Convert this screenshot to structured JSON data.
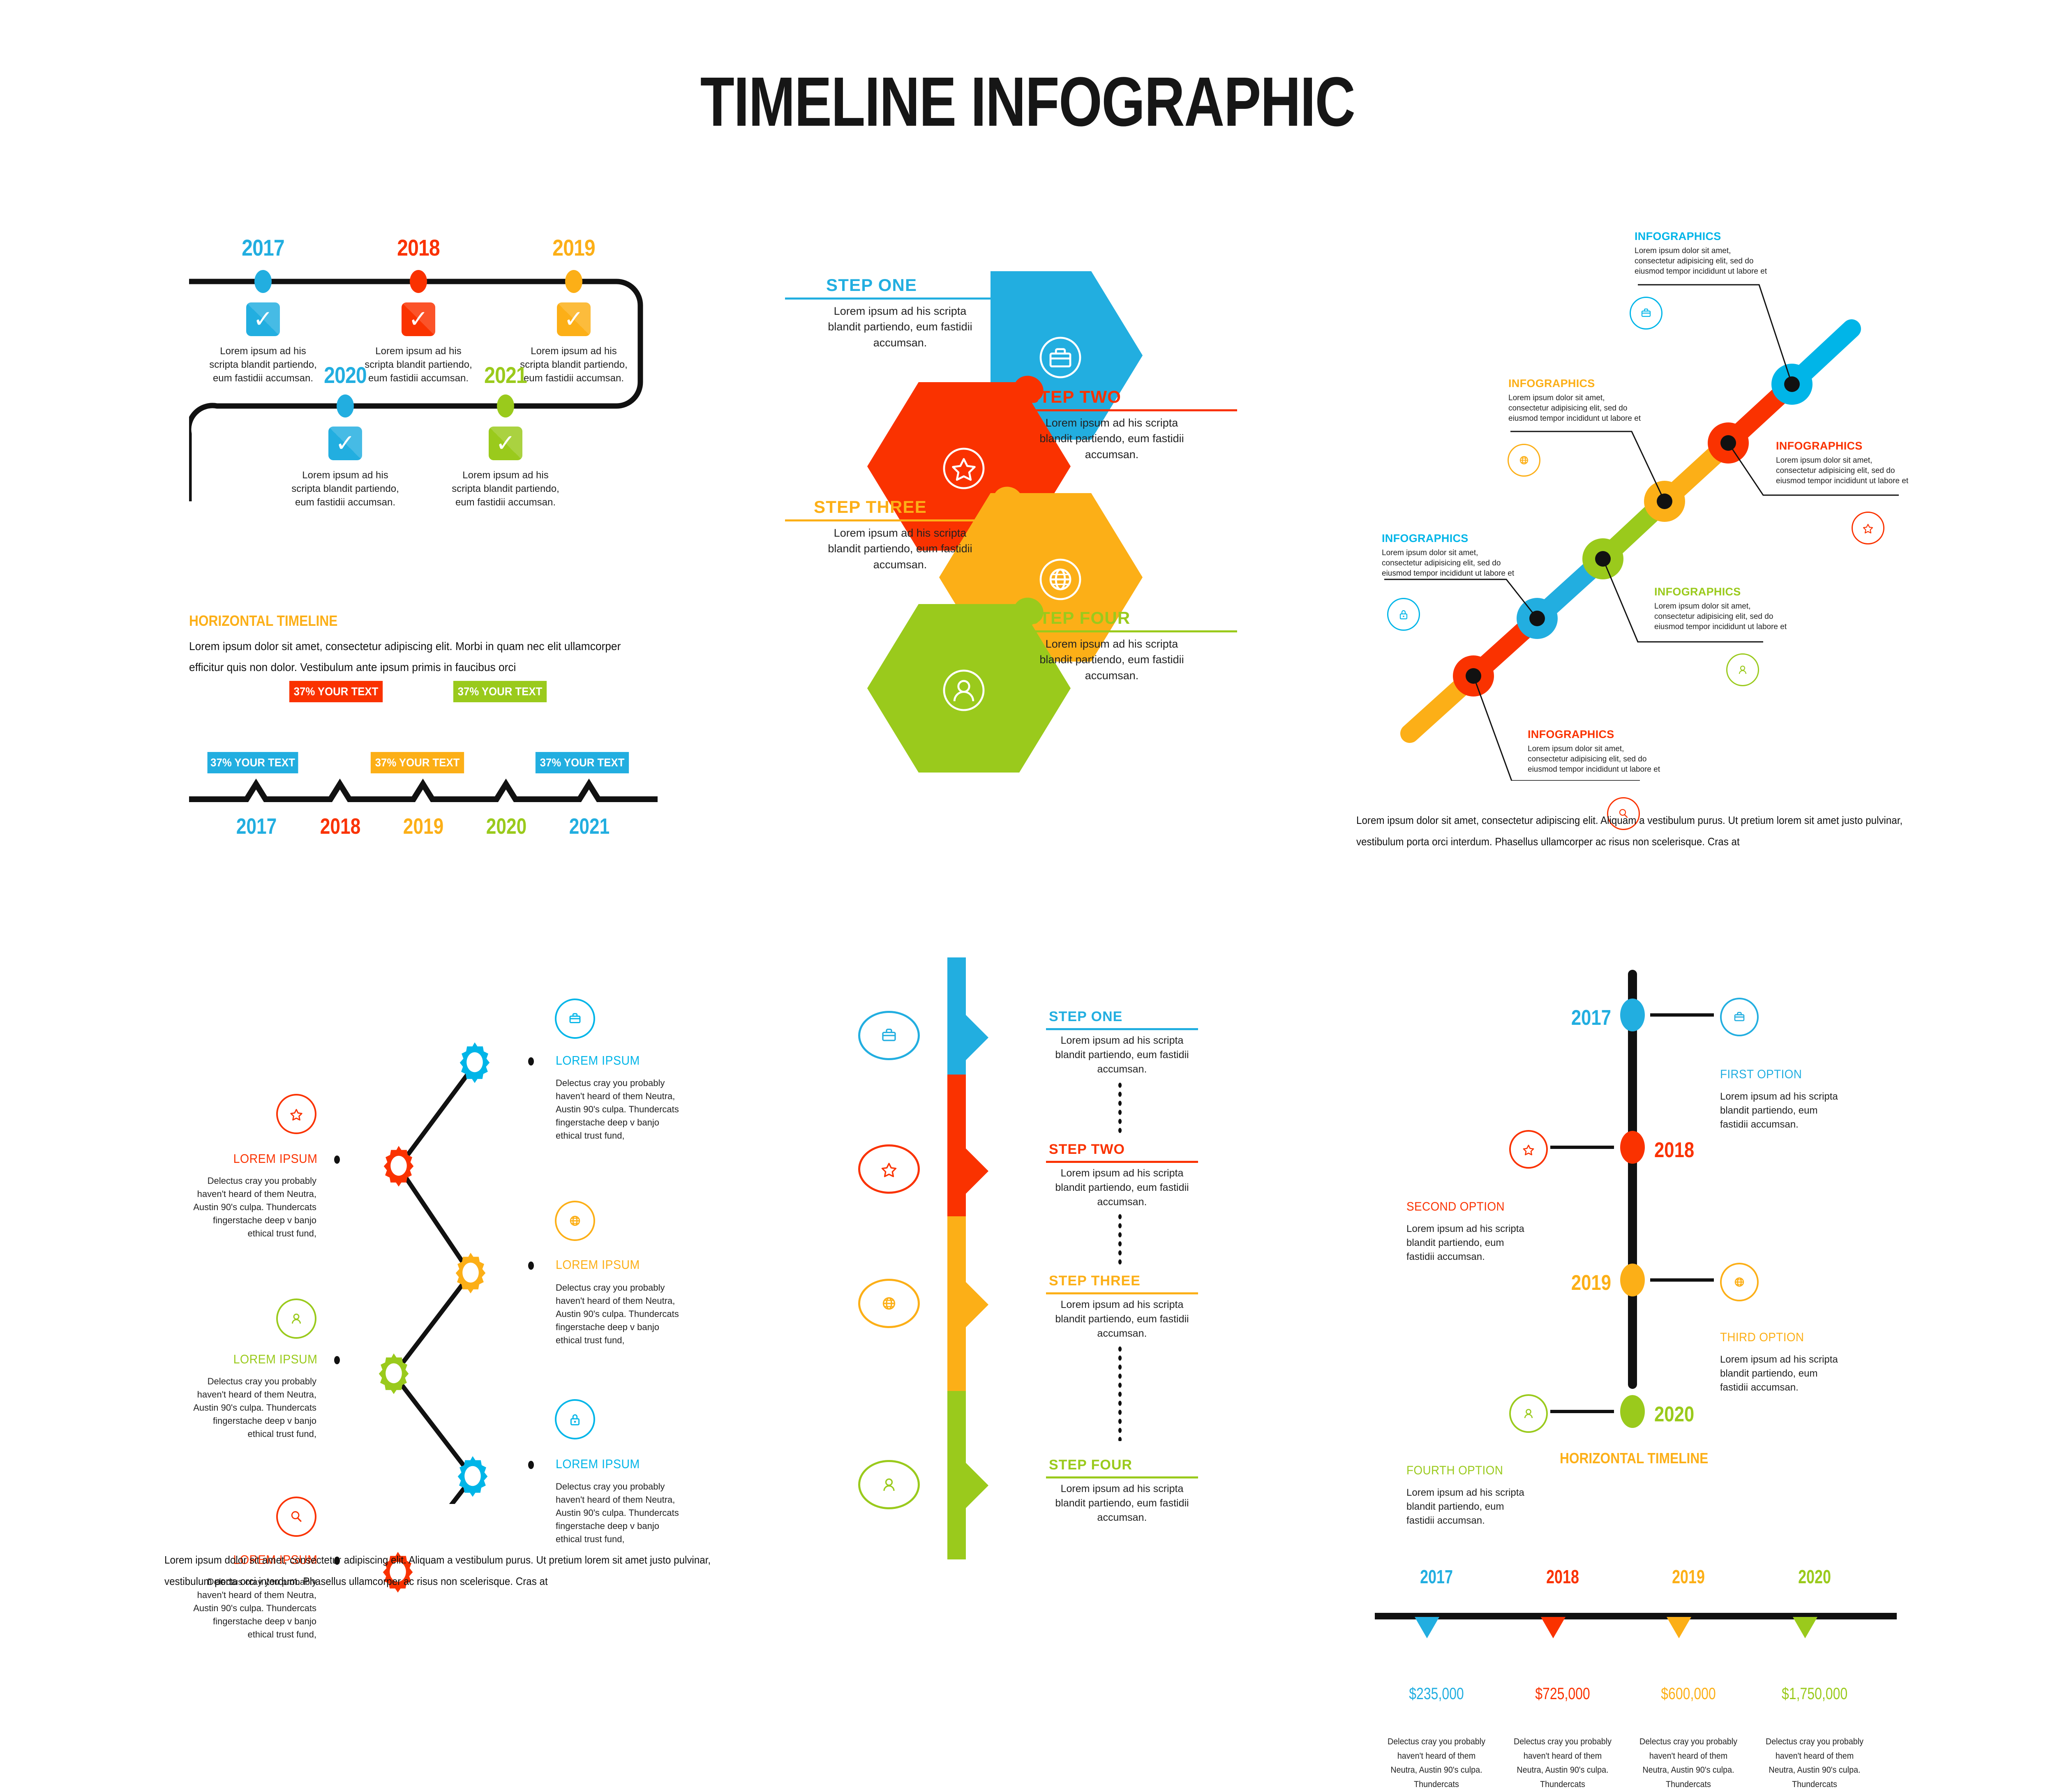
{
  "title": "TIMELINE INFOGRAPHIC",
  "colors": {
    "blue": "#22AEE0",
    "blue_bright": "#00B5E8",
    "red": "#FA3200",
    "orange": "#FCAF17",
    "orange_deep": "#F9A51A",
    "green": "#9ACA1C",
    "black": "#111111"
  },
  "lorem": {
    "short": "Lorem ipsum ad his scripta blandit partiendo, eum fastidii accumsan.",
    "info": "Lorem ipsum dolor sit amet, consectetur adipisicing elit, sed do eiusmod tempor incididunt ut labore et",
    "delectus": "Delectus cray you probably haven't heard of them Neutra, Austin 90's culpa. Thundercats fingerstache deep v banjo ethical trust fund,",
    "delectus_short": "Delectus cray you probably haven't heard of them Neutra, Austin 90's culpa. Thundercats"
  },
  "snake_timeline": {
    "items": [
      {
        "year": "2017",
        "color": "#22AEE0",
        "icon": "check-icon",
        "text": "Lorem ipsum ad his scripta blandit partiendo, eum fastidii accumsan."
      },
      {
        "year": "2018",
        "color": "#FA3200",
        "icon": "check-icon",
        "text": "Lorem ipsum ad his scripta blandit partiendo, eum fastidii accumsan."
      },
      {
        "year": "2019",
        "color": "#FCAF17",
        "icon": "check-icon",
        "text": "Lorem ipsum ad his scripta blandit partiendo, eum fastidii accumsan."
      },
      {
        "year": "2020",
        "color": "#22AEE0",
        "icon": "check-icon",
        "text": "Lorem ipsum ad his scripta blandit partiendo, eum fastidii accumsan."
      },
      {
        "year": "2021",
        "color": "#9ACA1C",
        "icon": "check-icon",
        "text": "Lorem ipsum ad his scripta blandit partiendo, eum fastidii accumsan."
      }
    ]
  },
  "horizontal_timeline": {
    "heading": "HORIZONTAL TIMELINE",
    "intro": "Lorem ipsum dolor sit amet, consectetur adipiscing elit. Morbi in quam nec elit ullamcorper efficitur quis non dolor. Vestibulum ante ipsum primis in faucibus orci",
    "badges": [
      {
        "label": "37% YOUR TEXT",
        "color": "#22AEE0",
        "row": "low"
      },
      {
        "label": "37% YOUR TEXT",
        "color": "#FA3200",
        "row": "high"
      },
      {
        "label": "37% YOUR TEXT",
        "color": "#FCAF17",
        "row": "low"
      },
      {
        "label": "37% YOUR TEXT",
        "color": "#9ACA1C",
        "row": "high"
      },
      {
        "label": "37% YOUR TEXT",
        "color": "#22AEE0",
        "row": "low"
      }
    ],
    "years": [
      {
        "label": "2017",
        "color": "#22AEE0"
      },
      {
        "label": "2018",
        "color": "#FA3200"
      },
      {
        "label": "2019",
        "color": "#FCAF17"
      },
      {
        "label": "2020",
        "color": "#9ACA1C"
      },
      {
        "label": "2021",
        "color": "#22AEE0"
      }
    ]
  },
  "puzzle_steps": {
    "items": [
      {
        "label": "STEP ONE",
        "color": "#22AEE0",
        "icon": "briefcase-icon",
        "text": "Lorem ipsum ad his scripta blandit partiendo, eum fastidii accumsan.",
        "side": "left"
      },
      {
        "label": "STEP TWO",
        "color": "#FA3200",
        "icon": "star-icon",
        "text": "Lorem ipsum ad his scripta blandit partiendo, eum fastidii accumsan.",
        "side": "right"
      },
      {
        "label": "STEP THREE",
        "color": "#FCAF17",
        "icon": "globe-icon",
        "text": "Lorem ipsum ad his scripta blandit partiendo, eum fastidii accumsan.",
        "side": "left"
      },
      {
        "label": "STEP FOUR",
        "color": "#9ACA1C",
        "icon": "user-icon",
        "text": "Lorem ipsum ad his scripta blandit partiendo, eum fastidii accumsan.",
        "side": "right"
      }
    ]
  },
  "diagonal_timeline": {
    "items": [
      {
        "label": "INFOGRAPHICS",
        "color": "#00B5E8",
        "icon": "briefcase-icon",
        "text": "Lorem ipsum dolor sit amet, consectetur adipisicing elit, sed do eiusmod tempor incididunt ut labore et"
      },
      {
        "label": "INFOGRAPHICS",
        "color": "#FA3200",
        "icon": "star-icon",
        "text": "Lorem ipsum dolor sit amet, consectetur adipisicing elit, sed do eiusmod tempor incididunt ut labore et"
      },
      {
        "label": "INFOGRAPHICS",
        "color": "#FCAF17",
        "icon": "globe-icon",
        "text": "Lorem ipsum dolor sit amet, consectetur adipisicing elit, sed do eiusmod tempor incididunt ut labore et"
      },
      {
        "label": "INFOGRAPHICS",
        "color": "#9ACA1C",
        "icon": "user-icon",
        "text": "Lorem ipsum dolor sit amet, consectetur adipisicing elit, sed do eiusmod tempor incididunt ut labore et"
      },
      {
        "label": "INFOGRAPHICS",
        "color": "#00B5E8",
        "icon": "lock-icon",
        "text": "Lorem ipsum dolor sit amet, consectetur adipisicing elit, sed do eiusmod tempor incididunt ut labore et"
      },
      {
        "label": "INFOGRAPHICS",
        "color": "#FA3200",
        "icon": "search-icon",
        "text": "Lorem ipsum dolor sit amet, consectetur adipisicing elit, sed do eiusmod tempor incididunt ut labore et"
      }
    ],
    "footer": "Lorem ipsum dolor sit amet, consectetur adipiscing elit. Aliquam a vestibulum purus. Ut pretium lorem sit amet justo pulvinar, vestibulum porta orci interdum. Phasellus ullamcorper ac risus non scelerisque. Cras at"
  },
  "gear_timeline": {
    "items": [
      {
        "label": "LOREM IPSUM",
        "color": "#00B5E8",
        "icon": "briefcase-icon",
        "side": "right",
        "text": "Delectus cray you probably haven't heard of them Neutra, Austin 90's culpa. Thundercats fingerstache deep v banjo ethical trust fund,"
      },
      {
        "label": "LOREM IPSUM",
        "color": "#FA3200",
        "icon": "star-icon",
        "side": "left",
        "text": "Delectus cray you probably haven't heard of them Neutra, Austin 90's culpa. Thundercats fingerstache deep v banjo ethical trust fund,"
      },
      {
        "label": "LOREM IPSUM",
        "color": "#FCAF17",
        "icon": "globe-icon",
        "side": "right",
        "text": "Delectus cray you probably haven't heard of them Neutra, Austin 90's culpa. Thundercats fingerstache deep v banjo ethical trust fund,"
      },
      {
        "label": "LOREM IPSUM",
        "color": "#9ACA1C",
        "icon": "user-icon",
        "side": "left",
        "text": "Delectus cray you probably haven't heard of them Neutra, Austin 90's culpa. Thundercats fingerstache deep v banjo ethical trust fund,"
      },
      {
        "label": "LOREM IPSUM",
        "color": "#00B5E8",
        "icon": "lock-icon",
        "side": "right",
        "text": "Delectus cray you probably haven't heard of them Neutra, Austin 90's culpa. Thundercats fingerstache deep v banjo ethical trust fund,"
      },
      {
        "label": "LOREM IPSUM",
        "color": "#FA3200",
        "icon": "search-icon",
        "side": "left",
        "text": "Delectus cray you probably haven't heard of them Neutra, Austin 90's culpa. Thundercats fingerstache deep v banjo ethical trust fund,"
      }
    ],
    "footer": "Lorem ipsum dolor sit amet, consectetur adipiscing elit. Aliquam a vestibulum purus. Ut pretium lorem sit amet justo pulvinar, vestibulum porta orci interdum. Phasellus ullamcorper ac risus non scelerisque. Cras at"
  },
  "vertical_steps": {
    "items": [
      {
        "label": "STEP ONE",
        "color": "#22AEE0",
        "icon": "briefcase-icon",
        "text": "Lorem ipsum ad his scripta blandit partiendo, eum fastidii accumsan."
      },
      {
        "label": "STEP TWO",
        "color": "#FA3200",
        "icon": "star-icon",
        "text": "Lorem ipsum ad his scripta blandit partiendo, eum fastidii accumsan."
      },
      {
        "label": "STEP THREE",
        "color": "#FCAF17",
        "icon": "globe-icon",
        "text": "Lorem ipsum ad his scripta blandit partiendo, eum fastidii accumsan."
      },
      {
        "label": "STEP FOUR",
        "color": "#9ACA1C",
        "icon": "user-icon",
        "text": "Lorem ipsum ad his scripta blandit partiendo, eum fastidii accumsan."
      }
    ]
  },
  "vertical_years": {
    "items": [
      {
        "year": "2017",
        "label": "FIRST OPTION",
        "color": "#22AEE0",
        "icon": "briefcase-icon",
        "side": "right",
        "text": "Lorem ipsum ad his scripta blandit partiendo, eum fastidii accumsan."
      },
      {
        "year": "2018",
        "label": "SECOND OPTION",
        "color": "#FA3200",
        "icon": "star-icon",
        "side": "left",
        "text": "Lorem ipsum ad his scripta blandit partiendo, eum fastidii accumsan."
      },
      {
        "year": "2019",
        "label": "THIRD OPTION",
        "color": "#FCAF17",
        "icon": "globe-icon",
        "side": "right",
        "text": "Lorem ipsum ad his scripta blandit partiendo, eum fastidii accumsan."
      },
      {
        "year": "2020",
        "label": "FOURTH OPTION",
        "color": "#9ACA1C",
        "icon": "user-icon",
        "side": "left",
        "text": "Lorem ipsum ad his scripta blandit partiendo, eum fastidii accumsan."
      }
    ]
  },
  "money_timeline": {
    "heading": "HORIZONTAL TIMELINE",
    "items": [
      {
        "year": "2017",
        "value": "$235,000",
        "color": "#22AEE0",
        "text": "Delectus cray you probably haven't heard of them Neutra, Austin 90's culpa. Thundercats"
      },
      {
        "year": "2018",
        "value": "$725,000",
        "color": "#FA3200",
        "text": "Delectus cray you probably haven't heard of them Neutra, Austin 90's culpa. Thundercats"
      },
      {
        "year": "2019",
        "value": "$600,000",
        "color": "#FCAF17",
        "text": "Delectus cray you probably haven't heard of them Neutra, Austin 90's culpa. Thundercats"
      },
      {
        "year": "2020",
        "value": "$1,750,000",
        "color": "#9ACA1C",
        "text": "Delectus cray you probably haven't heard of them Neutra, Austin 90's culpa. Thundercats"
      }
    ]
  },
  "chart_data": {
    "type": "table",
    "title": "TIMELINE INFOGRAPHIC",
    "categories": [
      "2017",
      "2018",
      "2019",
      "2020"
    ],
    "values": [
      235000,
      725000,
      600000,
      1750000
    ],
    "value_labels": [
      "$235,000",
      "$725,000",
      "$600,000",
      "$1,750,000"
    ],
    "percent_labels": [
      "37%",
      "37%",
      "37%",
      "37%",
      "37%"
    ],
    "percent_years": [
      "2017",
      "2018",
      "2019",
      "2020",
      "2021"
    ],
    "ylabel": "",
    "xlabel": ""
  }
}
